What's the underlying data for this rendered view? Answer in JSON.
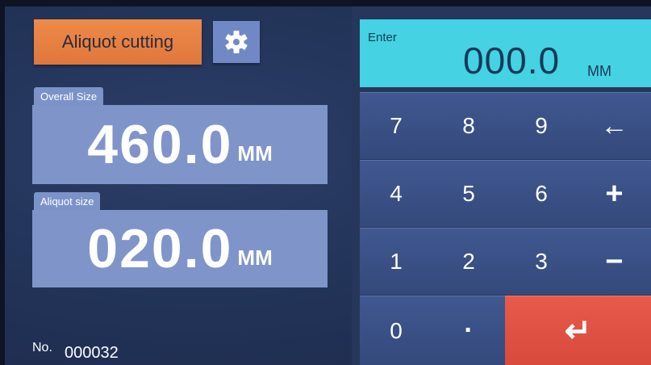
{
  "left_panel": {
    "mode_button_label": "Aliquot cutting",
    "settings_icon": "gear-icon",
    "overall": {
      "label": "Overall Size",
      "value": "460.0",
      "unit": "MM"
    },
    "aliquot": {
      "label": "Aliquot size",
      "value": "020.0",
      "unit": "MM"
    },
    "counter": {
      "label": "No.",
      "value": "000032"
    }
  },
  "entry_display": {
    "label": "Enter",
    "value": "000.0",
    "unit": "MM"
  },
  "keypad": {
    "keys": {
      "k7": "7",
      "k8": "8",
      "k9": "9",
      "backspace": "←",
      "k4": "4",
      "k5": "5",
      "k6": "6",
      "plus": "+",
      "k1": "1",
      "k2": "2",
      "k3": "3",
      "minus": "−",
      "k0": "0",
      "dot": "·",
      "enter": "↵"
    }
  },
  "colors": {
    "mode_button": "#e8823f",
    "panel": "#7f95c9",
    "display": "#45d2e2",
    "enter_key": "#e05243",
    "key": "#3a5087"
  }
}
